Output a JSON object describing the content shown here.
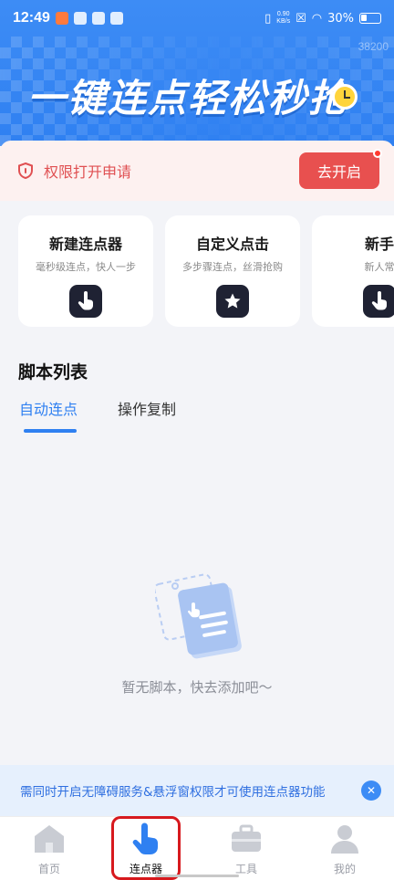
{
  "status_bar": {
    "time": "12:49",
    "net_speed_value": "0.90",
    "net_speed_unit": "KB/s",
    "battery": "30%"
  },
  "banner": {
    "ghost_number": "38200",
    "title": "一键连点轻松秒抢"
  },
  "permission": {
    "text": "权限打开申请",
    "button": "去开启"
  },
  "cards": [
    {
      "title": "新建连点器",
      "subtitle": "毫秒级连点，快人一步",
      "icon": "hand-tap-icon"
    },
    {
      "title": "自定义点击",
      "subtitle": "多步骤连点，丝滑抢购",
      "icon": "star-icon"
    },
    {
      "title": "新手",
      "subtitle": "新人常",
      "icon": "hand-tap-icon"
    }
  ],
  "script_list": {
    "title": "脚本列表",
    "tabs": [
      "自动连点",
      "操作复制"
    ],
    "active_tab": 0,
    "empty_text": "暂无脚本，快去添加吧～"
  },
  "notice": {
    "text": "需同时开启无障碍服务&悬浮窗权限才可使用连点器功能"
  },
  "bottom_nav": {
    "items": [
      {
        "label": "首页",
        "icon": "home-icon"
      },
      {
        "label": "连点器",
        "icon": "hand-pointer-icon"
      },
      {
        "label": "工具",
        "icon": "toolbox-icon"
      },
      {
        "label": "我的",
        "icon": "profile-icon"
      }
    ],
    "active": 1
  },
  "colors": {
    "brand_blue": "#2f80f1",
    "alert_red": "#e8504f",
    "highlight_outline": "#d7191e"
  }
}
